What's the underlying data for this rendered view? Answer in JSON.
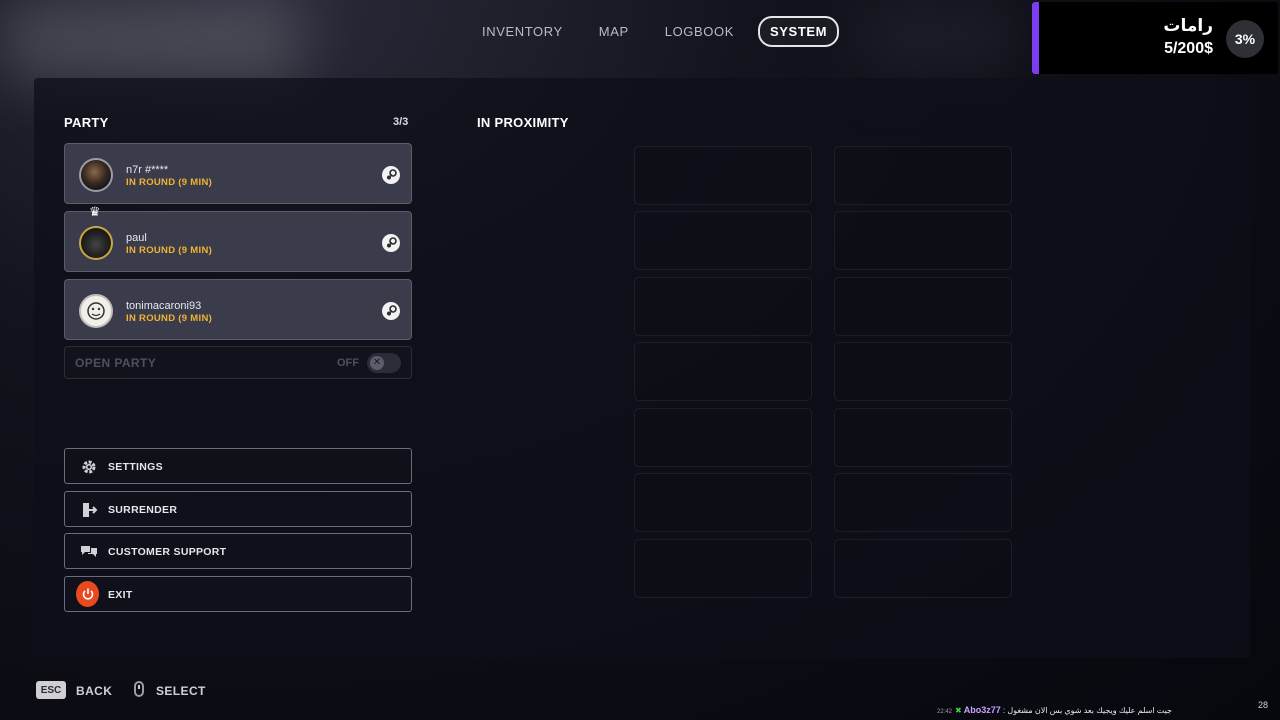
{
  "nav": {
    "tabs": [
      {
        "label": "INVENTORY",
        "active": false
      },
      {
        "label": "MAP",
        "active": false
      },
      {
        "label": "LOGBOOK",
        "active": false
      },
      {
        "label": "SYSTEM",
        "active": true
      }
    ]
  },
  "quest": {
    "title": "رامات",
    "progress_text": "5/200$",
    "percent": "3%",
    "accent_color": "#7a3df0"
  },
  "party": {
    "heading": "PARTY",
    "count": "3/3",
    "members": [
      {
        "name": "n7r #****",
        "status": "IN ROUND (9 MIN)",
        "platform_icon": "steam-icon"
      },
      {
        "name": "paul",
        "status": "IN ROUND (9 MIN)",
        "platform_icon": "steam-icon",
        "leader_icon": "crown-icon"
      },
      {
        "name": "tonimacaroni93",
        "status": "IN ROUND (9 MIN)",
        "platform_icon": "steam-icon"
      }
    ],
    "open_party": {
      "label": "OPEN PARTY",
      "state": "OFF"
    }
  },
  "menu": {
    "settings": "SETTINGS",
    "surrender": "SURRENDER",
    "support": "CUSTOMER SUPPORT",
    "exit": "EXIT",
    "exit_color": "#e8491e"
  },
  "proximity": {
    "heading": "IN PROXIMITY"
  },
  "footer": {
    "back_key": "ESC",
    "back_label": "BACK",
    "select_label": "SELECT"
  },
  "chat": {
    "time": "22:42",
    "marker": "✖",
    "user": "Abo3z77",
    "message": ": جيت اسلم عليك ويجيك بعد شوي بس الان مشغول"
  },
  "corner_number": "28",
  "status_color": "#f2b233"
}
